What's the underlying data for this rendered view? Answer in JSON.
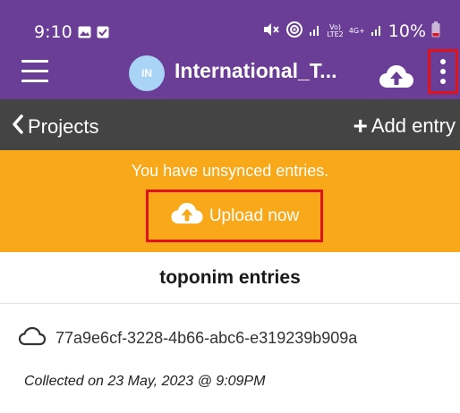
{
  "status_bar": {
    "time": "9:10",
    "battery": "10%",
    "network_top": "Vo)",
    "network_bottom": "LTE2",
    "signal_label": "4G+",
    "icons": [
      "photo-icon",
      "check-square-icon",
      "mute-icon",
      "wifi-icon",
      "signal-icon",
      "battery-icon"
    ]
  },
  "app_bar": {
    "avatar_initials": "IN",
    "title": "International_T...",
    "icons": [
      "menu-icon",
      "cloud-upload-icon",
      "more-vertical-icon"
    ]
  },
  "nav_bar": {
    "back_label": "Projects",
    "add_label": "Add entry"
  },
  "banner": {
    "message": "You have unsynced entries.",
    "upload_label": "Upload now"
  },
  "section": {
    "title": "toponim entries"
  },
  "entry": {
    "id": "77a9e6cf-3228-4b66-abc6-e319239b909a",
    "collected": "Collected on 23 May, 2023 @ 9:09PM"
  },
  "colors": {
    "app_bar": "#6a3d96",
    "nav_bar": "#444444",
    "banner": "#f9a81a",
    "highlight": "#e0131b",
    "avatar": "#a9d4f5"
  }
}
